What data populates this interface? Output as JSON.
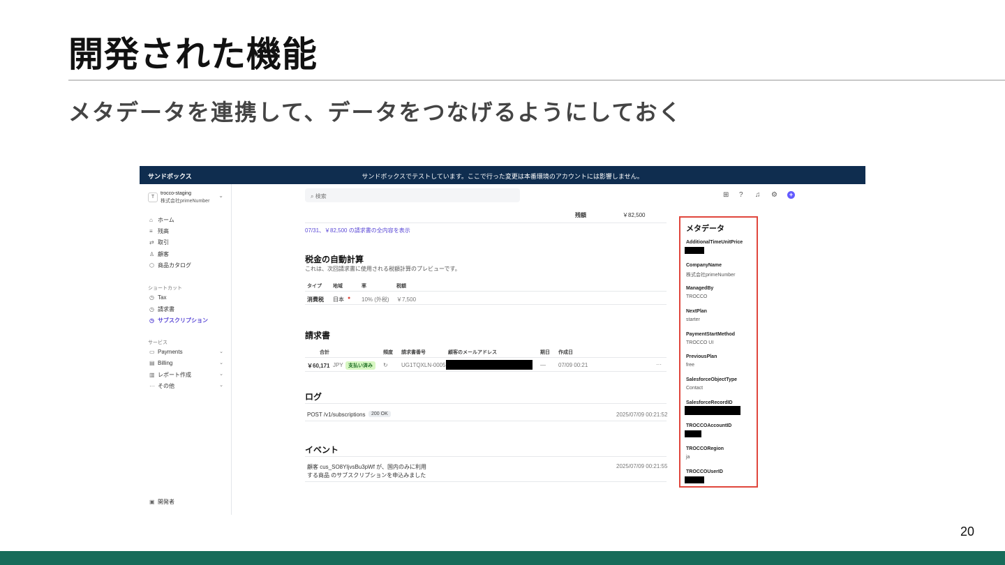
{
  "slide": {
    "title": "開発された機能",
    "subtitle": "メタデータを連携して、データをつなげるようにしておく",
    "page_number": "20"
  },
  "screenshot": {
    "sandbox_bar": {
      "left": "サンドボックス",
      "center": "サンドボックスでテストしています。ここで行った変更は本番環境のアカウントには影響しません。"
    },
    "account": {
      "initial": "T",
      "name": "trocco-staging",
      "org": "株式会社primeNumber"
    },
    "nav": [
      {
        "icon": "home-icon",
        "glyph": "⌂",
        "label": "ホーム"
      },
      {
        "icon": "balance-icon",
        "glyph": "≡",
        "label": "残高"
      },
      {
        "icon": "transactions-icon",
        "glyph": "⇄",
        "label": "取引"
      },
      {
        "icon": "customer-icon",
        "glyph": "♙",
        "label": "顧客"
      },
      {
        "icon": "catalog-icon",
        "glyph": "⬡",
        "label": "商品カタログ"
      }
    ],
    "shortcuts_label": "ショートカット",
    "shortcuts": [
      {
        "icon": "clock-icon",
        "glyph": "◷",
        "label": "Tax"
      },
      {
        "icon": "clock-icon",
        "glyph": "◷",
        "label": "請求書"
      },
      {
        "icon": "clock-icon",
        "glyph": "◷",
        "label": "サブスクリプション",
        "active": true
      }
    ],
    "services_label": "サービス",
    "services": [
      {
        "icon": "payments-icon",
        "glyph": "▭",
        "label": "Payments"
      },
      {
        "icon": "billing-icon",
        "glyph": "▤",
        "label": "Billing"
      },
      {
        "icon": "reports-icon",
        "glyph": "▥",
        "label": "レポート作成"
      },
      {
        "icon": "more-icon",
        "glyph": "···",
        "label": "その他"
      }
    ],
    "developer": {
      "icon": "terminal-icon",
      "glyph": "▣",
      "label": "開発者"
    },
    "search_placeholder": "検索",
    "balance": {
      "label": "残額",
      "value": "￥82,500"
    },
    "invoice_link": "07/31、￥82,500 の請求書の全内容を表示",
    "tax": {
      "title": "税金の自動計算",
      "desc": "これは、次回請求書に使用される税額計算のプレビューです。",
      "headers": [
        "タイプ",
        "地域",
        "率",
        "税額"
      ],
      "row": {
        "type": "消費税",
        "region": "日本",
        "rate": "10% (外税)",
        "amount": "￥7,500"
      }
    },
    "invoices": {
      "title": "請求書",
      "headers": [
        "合計",
        "頻度",
        "請求書番号",
        "顧客のメールアドレス",
        "期日",
        "作成日"
      ],
      "row": {
        "total": "￥60,171",
        "currency": "JPY",
        "status": "支払い済み",
        "freq": "↻",
        "number": "UG1TQXLN-0005",
        "due": "—",
        "created": "07/09 00:21",
        "more": "···"
      }
    },
    "logs": {
      "title": "ログ",
      "row": {
        "request": "POST /v1/subscriptions",
        "status": "200 OK",
        "time": "2025/07/09 00:21:52"
      }
    },
    "events": {
      "title": "イベント",
      "row": {
        "line1": "顧客 cus_SO8YIjvsBu3pWf が、国内のみに利用",
        "line2": "する商品 のサブスクリプションを申込みました",
        "time": "2025/07/09 00:21:55"
      }
    },
    "metadata": {
      "title": "メタデータ",
      "items": [
        {
          "key": "AdditionalTimeUnitPrice",
          "value": ""
        },
        {
          "key": "CompanyName",
          "value": "株式会社primeNumber"
        },
        {
          "key": "ManagedBy",
          "value": "TROCCO"
        },
        {
          "key": "NextPlan",
          "value": "starter"
        },
        {
          "key": "PaymentStartMethod",
          "value": "TROCCO UI"
        },
        {
          "key": "PreviousPlan",
          "value": "free"
        },
        {
          "key": "SalesforceObjectType",
          "value": "Contact"
        },
        {
          "key": "SalesforceRecordID",
          "value": ""
        },
        {
          "key": "TROCCOAccountID",
          "value": ""
        },
        {
          "key": "TROCCORegion",
          "value": "ja"
        },
        {
          "key": "TROCCOUserID",
          "value": ""
        }
      ]
    }
  }
}
